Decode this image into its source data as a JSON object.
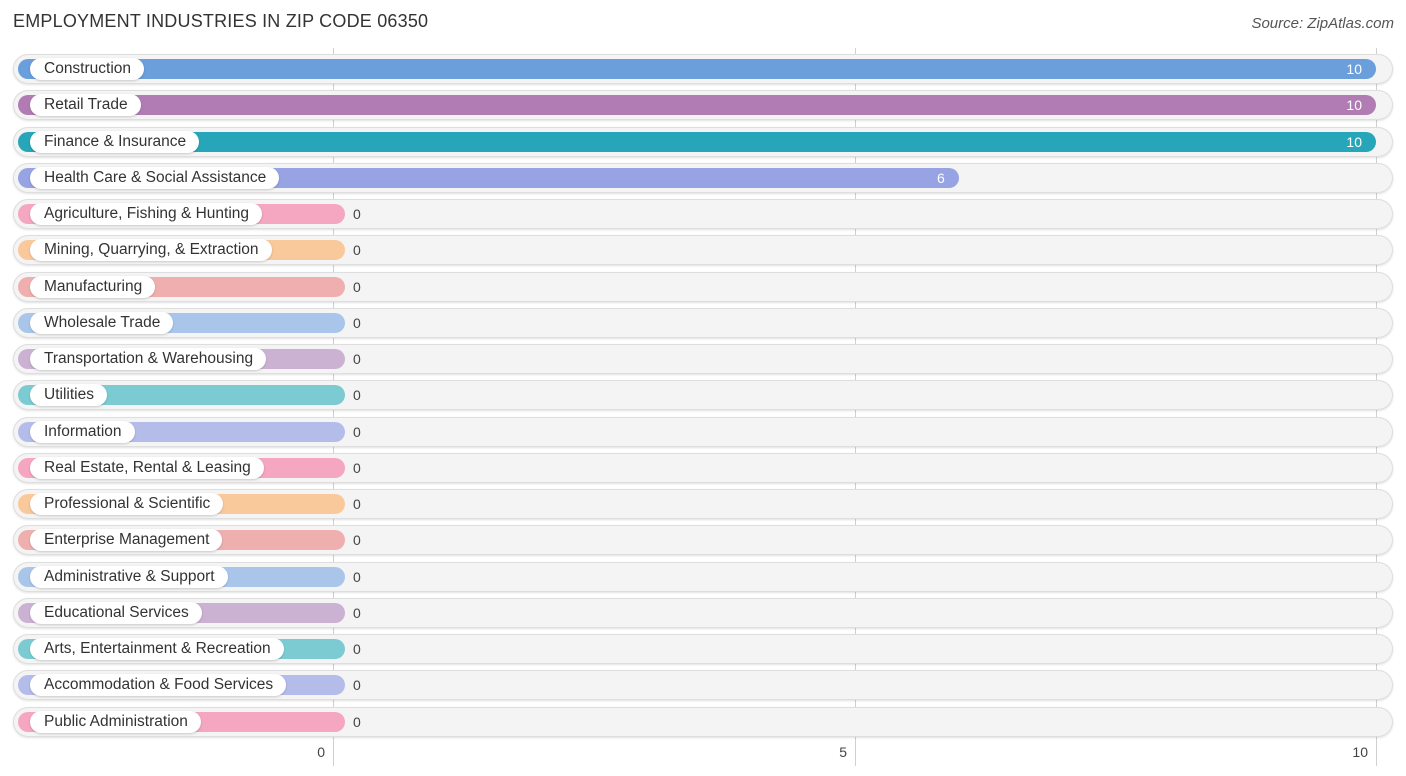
{
  "chart_data": {
    "type": "bar",
    "orientation": "horizontal",
    "title": "EMPLOYMENT INDUSTRIES IN ZIP CODE 06350",
    "source": "Source: ZipAtlas.com",
    "xlabel": "",
    "ylabel": "",
    "xlim": [
      0,
      10
    ],
    "xticks": [
      0,
      5,
      10
    ],
    "xtick_labels": [
      "0",
      "5",
      "10"
    ],
    "grid": true,
    "categories": [
      "Construction",
      "Retail Trade",
      "Finance & Insurance",
      "Health Care & Social Assistance",
      "Agriculture, Fishing & Hunting",
      "Mining, Quarrying, & Extraction",
      "Manufacturing",
      "Wholesale Trade",
      "Transportation & Warehousing",
      "Utilities",
      "Information",
      "Real Estate, Rental & Leasing",
      "Professional & Scientific",
      "Enterprise Management",
      "Administrative & Support",
      "Educational Services",
      "Arts, Entertainment & Recreation",
      "Accommodation & Food Services",
      "Public Administration"
    ],
    "values": [
      10,
      10,
      10,
      6,
      0,
      0,
      0,
      0,
      0,
      0,
      0,
      0,
      0,
      0,
      0,
      0,
      0,
      0,
      0
    ],
    "value_labels": [
      "10",
      "10",
      "10",
      "6",
      "0",
      "0",
      "0",
      "0",
      "0",
      "0",
      "0",
      "0",
      "0",
      "0",
      "0",
      "0",
      "0",
      "0",
      "0"
    ],
    "colors": [
      "#6a9fdc",
      "#b07cb3",
      "#26a6b8",
      "#97a3e3",
      "#f5a6c1",
      "#f9c99b",
      "#efafaf",
      "#a9c6ea",
      "#cbb1d2",
      "#7dcbd2",
      "#b4bdea",
      "#f5a6c1",
      "#f9c99b",
      "#efafaf",
      "#a9c6ea",
      "#cbb1d2",
      "#7dcbd2",
      "#b4bdea",
      "#f5a6c1"
    ]
  }
}
